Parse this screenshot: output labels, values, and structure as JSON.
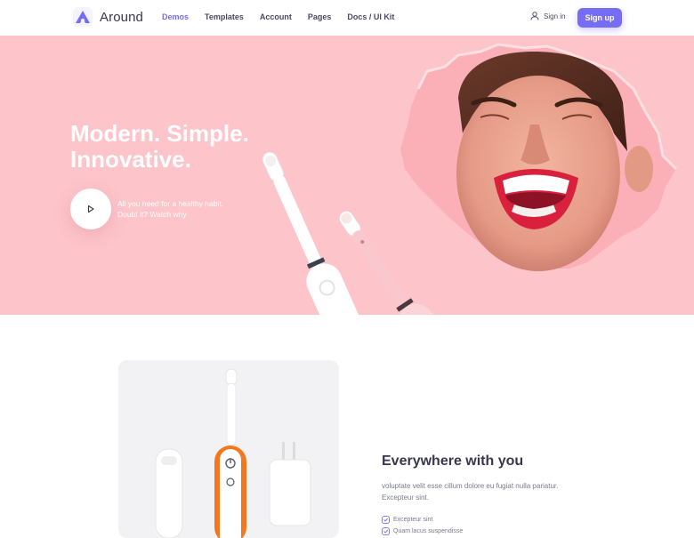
{
  "brand": {
    "name": "Around"
  },
  "nav": [
    {
      "label": "Demos",
      "active": true
    },
    {
      "label": "Templates"
    },
    {
      "label": "Account"
    },
    {
      "label": "Pages"
    },
    {
      "label": "Docs / UI Kit"
    }
  ],
  "header_actions": {
    "signin_label": "Sign in",
    "signup_label": "Sign up"
  },
  "hero": {
    "title_line1": "Modern. Simple.",
    "title_line2": "Innovative.",
    "subtitle_line1": "All you need for a healthy habit.",
    "subtitle_line2": "Doubt it? Watch why"
  },
  "feature": {
    "title": "Everywhere with you",
    "text": "voluptate velit esse cillum dolore eu fugiat nulla pariatur. Excepteur sint.",
    "checklist": [
      "Excepteur sint",
      "Quam lacus suspendisse"
    ]
  },
  "colors": {
    "accent": "#766df4",
    "hero_bg": "#fdc4ca",
    "heading": "#37384e",
    "muted": "#7a7b8e"
  },
  "icons": {
    "logo": "brand-logo-icon",
    "user": "user-icon",
    "play": "play-icon",
    "check": "check-circle-icon"
  }
}
